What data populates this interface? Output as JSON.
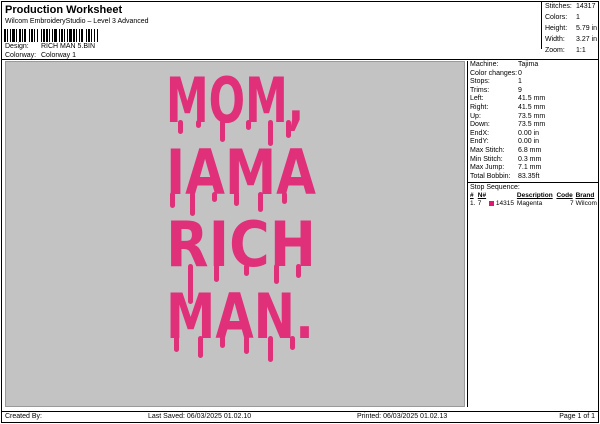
{
  "header": {
    "title": "Production Worksheet",
    "subtitle": "Wilcom EmbroideryStudio – Level 3 Advanced",
    "design_label": "Design:",
    "design_value": "RICH MAN 5.BIN",
    "colorway_label": "Colorway:",
    "colorway_value": "Colorway 1"
  },
  "stats": {
    "items": [
      {
        "label": "Stitches:",
        "value": "14317"
      },
      {
        "label": "Colors:",
        "value": "1"
      },
      {
        "label": "Height:",
        "value": "5.79 in"
      },
      {
        "label": "Width:",
        "value": "3.27 in"
      },
      {
        "label": "Zoom:",
        "value": "1:1"
      }
    ]
  },
  "design": {
    "lines": [
      "MOM,",
      "IAMA",
      "RICH",
      "MAN."
    ],
    "thread_color": "#e0307a",
    "background": "#c3c3c3"
  },
  "machine_info": {
    "items": [
      {
        "label": "Machine:",
        "value": "Tajima"
      },
      {
        "label": "Color changes:",
        "value": "0"
      },
      {
        "label": "Stops:",
        "value": "1"
      },
      {
        "label": "Trims:",
        "value": "9"
      },
      {
        "label": "Left:",
        "value": "41.5 mm"
      },
      {
        "label": "Right:",
        "value": "41.5 mm"
      },
      {
        "label": "Up:",
        "value": "73.5 mm"
      },
      {
        "label": "Down:",
        "value": "73.5 mm"
      },
      {
        "label": "EndX:",
        "value": "0.00 in"
      },
      {
        "label": "EndY:",
        "value": "0.00 in"
      },
      {
        "label": "Max Stitch:",
        "value": "6.8 mm"
      },
      {
        "label": "Min Stitch:",
        "value": "0.3 mm"
      },
      {
        "label": "Max Jump:",
        "value": "7.1 mm"
      },
      {
        "label": "Total Bobbin:",
        "value": "83.35ft"
      }
    ]
  },
  "stop_sequence": {
    "title": "Stop Sequence:",
    "headers": [
      "#",
      "N#",
      "",
      "",
      "Description",
      "Code",
      "Brand"
    ],
    "rows": [
      {
        "num": "1.",
        "n": "7",
        "color": "#d81b6a",
        "stitches": "14315",
        "description": "Magenta",
        "code": "7",
        "brand": "Wilcom"
      }
    ]
  },
  "footer": {
    "created_by": "Created By:",
    "last_saved": "Last Saved: 06/03/2025 01.02.10",
    "printed": "Printed: 06/03/2025 01.02.13",
    "page": "Page 1 of 1"
  }
}
